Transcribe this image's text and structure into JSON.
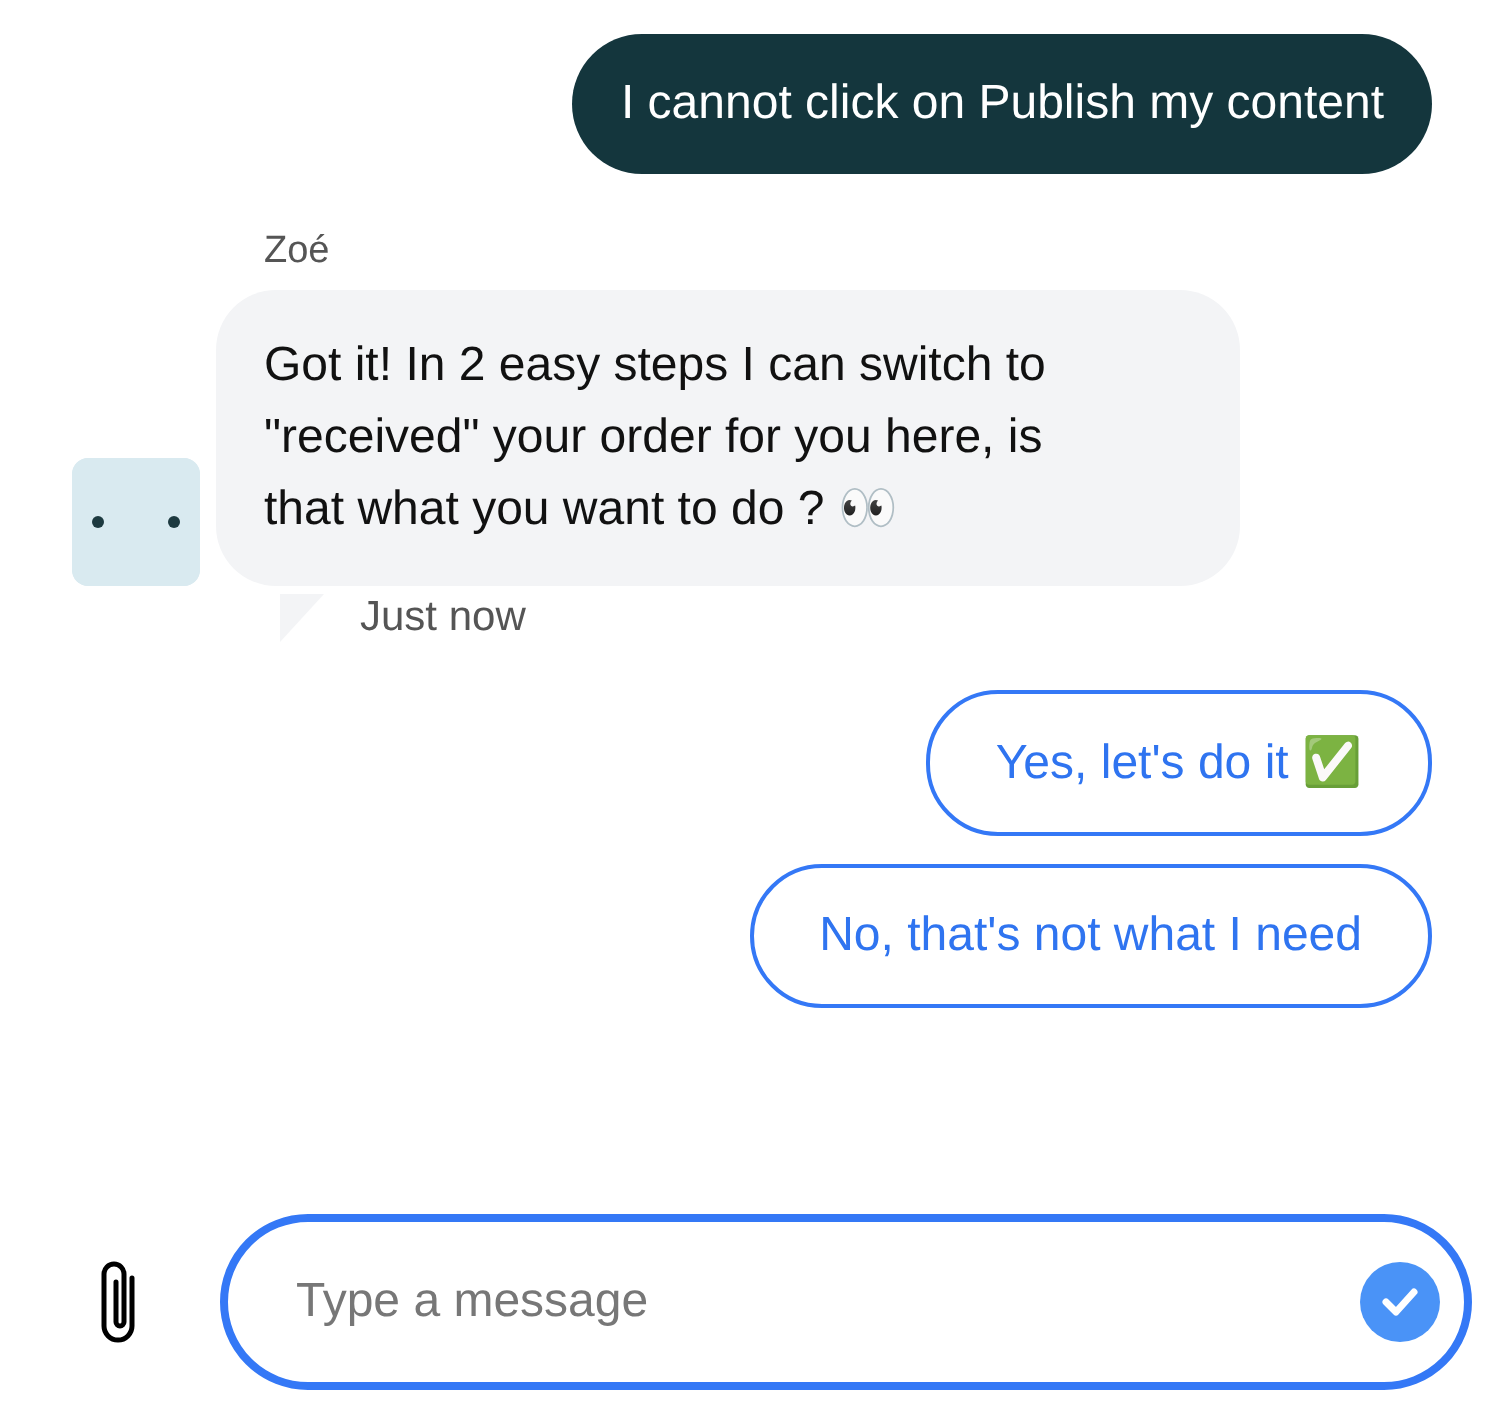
{
  "messages": [
    {
      "kind": "user",
      "text": "I cannot click on Publish my content"
    },
    {
      "kind": "bot",
      "sender": "Zoé",
      "text": "Got it! In 2 easy steps I can switch to \"received\" your order for you here, is that what you want to do ? 👀",
      "time": "Just now"
    }
  ],
  "quick_replies": [
    "Yes, let's do it ✅",
    "No, that's not what I need"
  ],
  "composer": {
    "placeholder": "Type a message"
  }
}
